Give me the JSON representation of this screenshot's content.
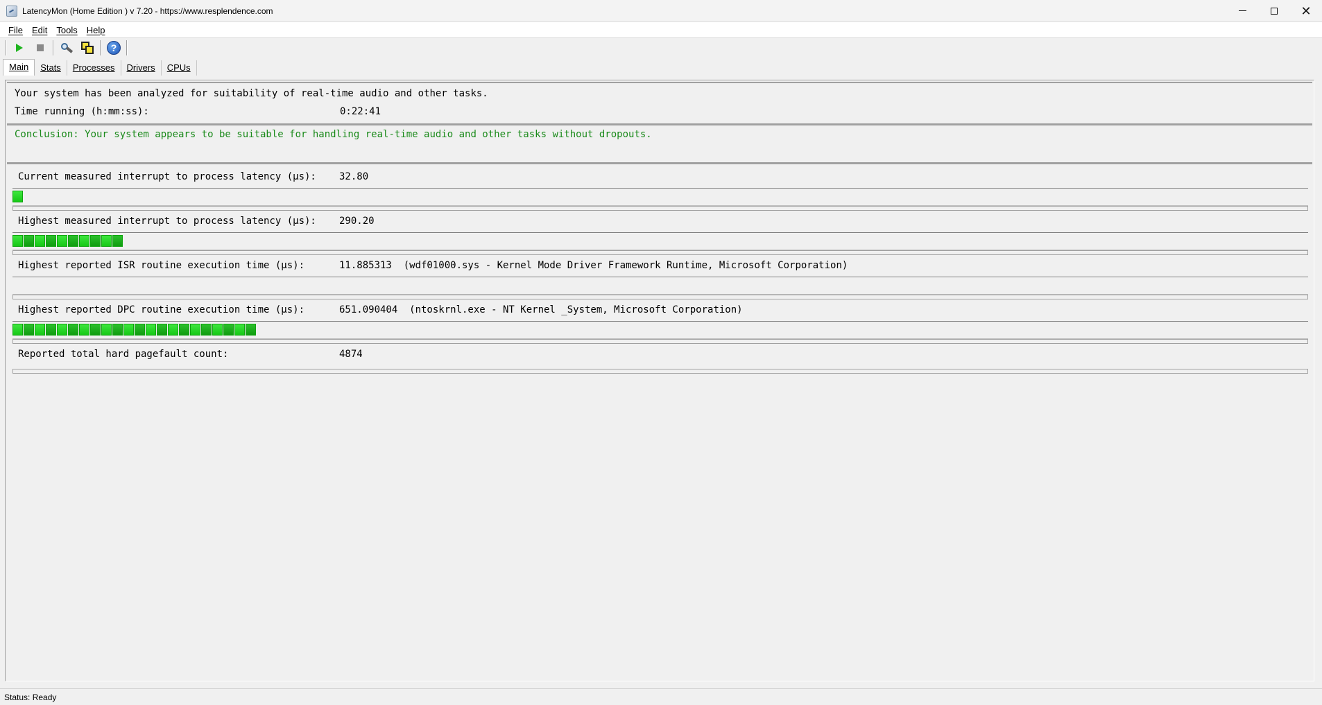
{
  "window": {
    "title": "LatencyMon  (Home Edition )  v 7.20 - https://www.resplendence.com",
    "minimize": "Minimize",
    "maximize": "Maximize",
    "close": "✕"
  },
  "menu": {
    "items": [
      "File",
      "Edit",
      "Tools",
      "Help"
    ]
  },
  "toolbar": {
    "icons": [
      "play-icon",
      "stop-icon",
      "tools-icon",
      "windows-icon",
      "help-icon"
    ],
    "help_glyph": "?"
  },
  "tabs": [
    "Main",
    "Stats",
    "Processes",
    "Drivers",
    "CPUs"
  ],
  "summary": {
    "analyzed": "Your system has been analyzed for suitability of real-time audio and other tasks.",
    "time_label": "Time running (h:mm:ss):",
    "time_value": "0:22:41",
    "conclusion": "Conclusion: Your system appears to be suitable for handling real-time audio and other tasks without dropouts."
  },
  "measurements": [
    {
      "label": "Current measured interrupt to process latency (µs):",
      "value": "32.80",
      "segments": 1
    },
    {
      "label": "Highest measured interrupt to process latency (µs):",
      "value": "290.20",
      "segments": 10
    },
    {
      "label": "Highest reported ISR routine execution time (µs):",
      "value": "11.885313  (wdf01000.sys - Kernel Mode Driver Framework Runtime, Microsoft Corporation)",
      "segments": 0
    },
    {
      "label": "Highest reported DPC routine execution time (µs):",
      "value": "651.090404  (ntoskrnl.exe - NT Kernel _System, Microsoft Corporation)",
      "segments": 22
    }
  ],
  "pagefault": {
    "label": "Reported total hard pagefault count:",
    "value": "4874"
  },
  "colors": {
    "bar_green": "#22d022",
    "conclusion_green": "#1a8a1a"
  },
  "status": "Status: Ready"
}
